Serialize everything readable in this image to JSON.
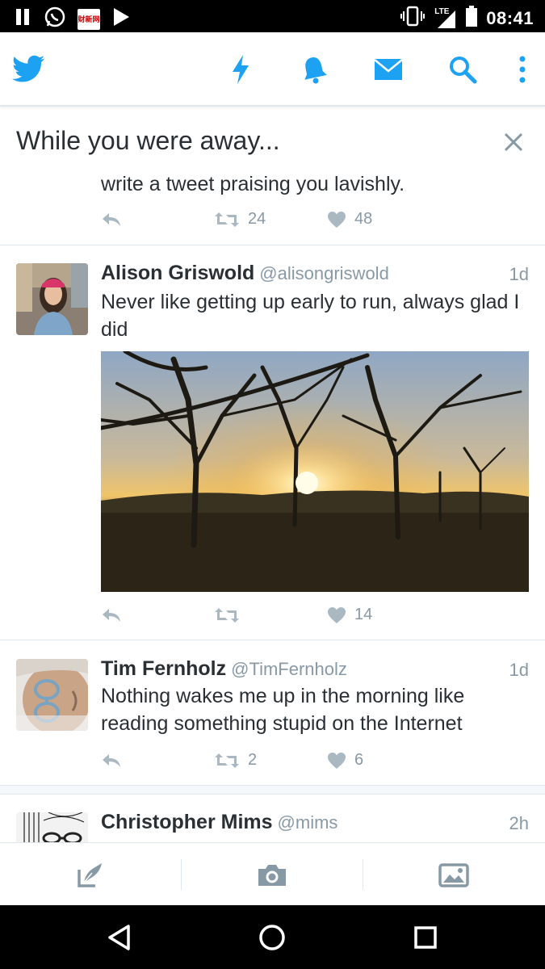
{
  "status_bar": {
    "time": "08:41",
    "network": "LTE",
    "news_icon_text": "财新网",
    "icons": [
      "pause-icon",
      "whatsapp-icon",
      "news-app-icon",
      "play-icon",
      "vibrate-icon",
      "signal-icon",
      "battery-icon"
    ]
  },
  "app_bar": {
    "icons": [
      "twitter-logo-icon",
      "moments-lightning-icon",
      "notifications-bell-icon",
      "messages-envelope-icon",
      "search-icon",
      "overflow-menu-icon"
    ],
    "accent_color": "#1da1f2"
  },
  "away": {
    "header": "While you were away...",
    "partial_tweet_text": "write a tweet praising you lavishly.",
    "retweets": "24",
    "likes": "48"
  },
  "tweets": [
    {
      "name": "Alison Griswold",
      "handle": "@alisongriswold",
      "time": "1d",
      "text": "Never like getting up early to run, always glad I did",
      "retweets": "",
      "likes": "14"
    },
    {
      "name": "Tim Fernholz",
      "handle": "@TimFernholz",
      "time": "1d",
      "text": "Nothing wakes me up in the morning like reading something stupid on the Internet",
      "retweets": "2",
      "likes": "6"
    },
    {
      "name": "Christopher Mims",
      "handle": "@mims",
      "time": "2h"
    }
  ],
  "compose_bar": {
    "icons": [
      "compose-tweet-icon",
      "camera-icon",
      "gallery-icon"
    ]
  },
  "nav_bar": {
    "icons": [
      "back-icon",
      "home-icon",
      "recents-icon"
    ]
  }
}
